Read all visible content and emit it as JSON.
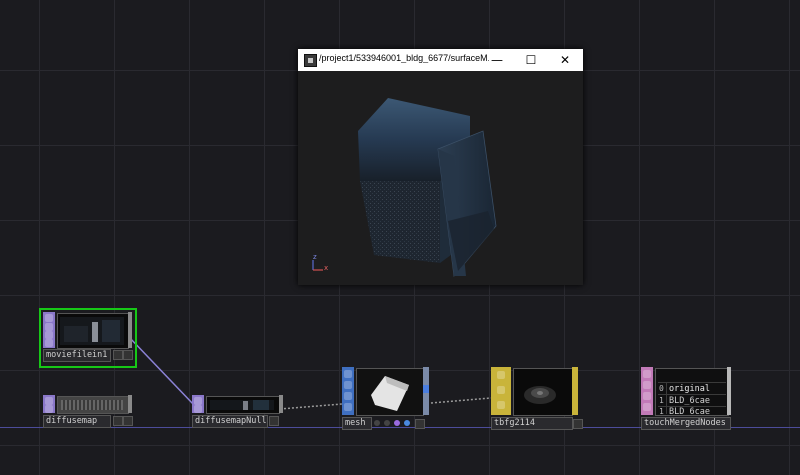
{
  "viewer": {
    "title": "/project1/533946001_bldg_6677/surfaceM...",
    "minimize_glyph": "—",
    "maximize_glyph": "☐",
    "close_glyph": "✕",
    "axis_labels": {
      "z": "z",
      "x": "x"
    }
  },
  "nodes": {
    "moviefilein": {
      "label": "moviefilein1",
      "family_color": "#8a77c9",
      "selected": true
    },
    "diffusemap": {
      "label": "diffusemap",
      "family_color": "#8a77c9"
    },
    "diffusemapnull": {
      "label": "diffusemapNull",
      "family_color": "#8a77c9"
    },
    "mesh": {
      "label": "mesh",
      "family_color": "#3f6fc0"
    },
    "tbfg": {
      "label": "tbfg2114",
      "family_color": "#c9b43a"
    },
    "merged": {
      "label": "touchMergedNodes",
      "family_color": "#c27ab8",
      "table_rows": [
        {
          "index": "0",
          "value": "original"
        },
        {
          "index": "1",
          "value": "BLD_6cae"
        },
        {
          "index": "1",
          "value": "BLD_6cae"
        }
      ]
    }
  },
  "colors": {
    "selection": "#17c817",
    "network_wire": "#8b82d6",
    "baseline": "#4c4c9a"
  }
}
